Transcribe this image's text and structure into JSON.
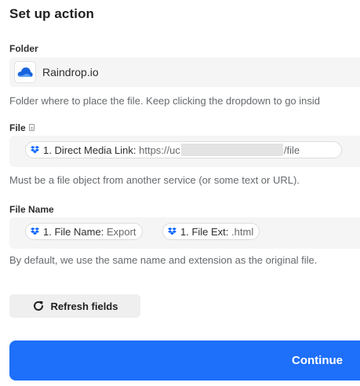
{
  "header": {
    "title": "Set up action"
  },
  "folder": {
    "label": "Folder",
    "app_icon": "cloud-icon",
    "value": "Raindrop.io",
    "help": "Folder where to place the file. Keep clicking the dropdown to go insid"
  },
  "file": {
    "label": "File",
    "label_icon": "document-icon",
    "pill": {
      "icon": "dropbox-icon",
      "step": "1. Direct Media Link:",
      "value_start": "https://uc",
      "value_end": "/file"
    },
    "help": "Must be a file object from another service (or some text or URL)."
  },
  "file_name": {
    "label": "File Name",
    "pills": [
      {
        "icon": "dropbox-icon",
        "step": "1. File Name:",
        "value": "Export"
      },
      {
        "icon": "dropbox-icon",
        "step": "1. File Ext:",
        "value": ".html"
      }
    ],
    "help": "By default, we use the same name and extension as the original file."
  },
  "actions": {
    "refresh_label": "Refresh fields",
    "continue_label": "Continue"
  },
  "colors": {
    "primary": "#1e6ffa",
    "field_bg": "#f5f5f5",
    "dropbox_blue": "#0061fe",
    "raindrop_blue": "#1863dc"
  }
}
